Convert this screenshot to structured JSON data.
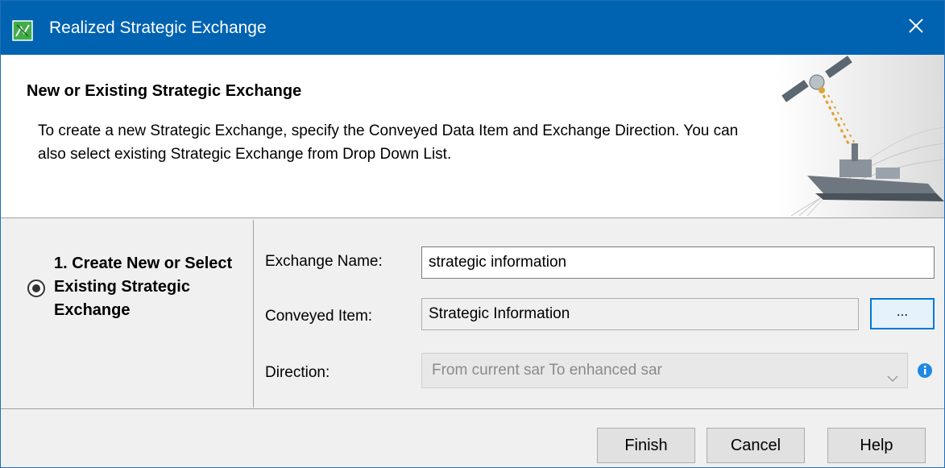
{
  "window": {
    "title": "Realized Strategic Exchange",
    "close_icon": "close-icon",
    "app_icon": "diagram-icon"
  },
  "banner": {
    "heading": "New or Existing Strategic Exchange",
    "description": "To create a new Strategic Exchange, specify the Conveyed Data Item and Exchange Direction. You can also select existing Strategic Exchange from Drop Down List.",
    "art": "satellite-ship-illustration"
  },
  "steps": [
    {
      "label": "1. Create New or Select Existing Strategic Exchange",
      "selected": true
    }
  ],
  "form": {
    "exchange_name_label": "Exchange Name:",
    "exchange_name_value": "strategic information",
    "conveyed_item_label": "Conveyed Item:",
    "conveyed_item_value": "Strategic Information",
    "browse_label": "...",
    "direction_label": "Direction:",
    "direction_value": "From current sar To enhanced sar",
    "direction_enabled": false
  },
  "footer": {
    "finish_label": "Finish",
    "cancel_label": "Cancel",
    "help_label": "Help"
  },
  "colors": {
    "titlebar": "#0063b1",
    "focus": "#0078d7",
    "info": "#1e88e5"
  }
}
